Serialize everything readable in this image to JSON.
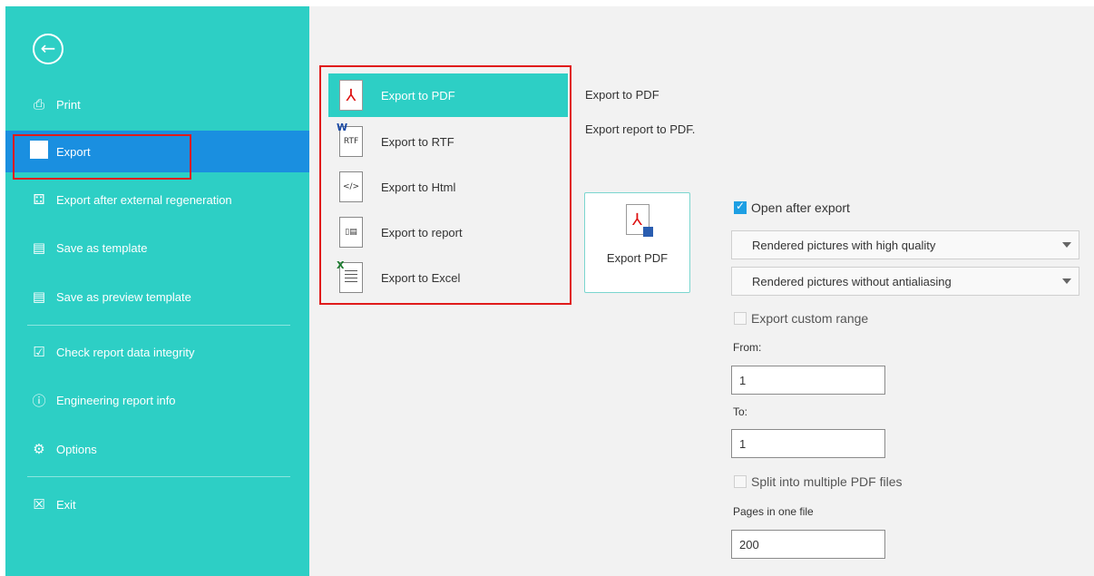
{
  "sidebar": {
    "back_icon": "arrow-left-circle-icon",
    "items": [
      {
        "label": "Print",
        "icon": "printer-icon"
      },
      {
        "label": "Export",
        "icon": "export-square-icon"
      },
      {
        "label": "Export after external regeneration",
        "icon": "regenerate-icon"
      },
      {
        "label": "Save as template",
        "icon": "template-icon"
      },
      {
        "label": "Save as preview template",
        "icon": "preview-template-icon"
      },
      {
        "label": "Check report data integrity",
        "icon": "check-doc-icon"
      },
      {
        "label": "Engineering report info",
        "icon": "info-doc-icon"
      },
      {
        "label": "Options",
        "icon": "gear-icon"
      },
      {
        "label": "Exit",
        "icon": "close-box-icon"
      }
    ]
  },
  "export_list": {
    "items": [
      {
        "label": "Export to PDF",
        "icon": "pdf-file-icon",
        "glyph": "⅄"
      },
      {
        "label": "Export to RTF",
        "icon": "rtf-file-icon",
        "glyph": "RTF"
      },
      {
        "label": "Export to Html",
        "icon": "html-file-icon",
        "glyph": "</>"
      },
      {
        "label": "Export to report",
        "icon": "report-file-icon",
        "glyph": "▯▤"
      },
      {
        "label": "Export to Excel",
        "icon": "excel-file-icon",
        "glyph": ""
      }
    ]
  },
  "detail": {
    "title": "Export to PDF",
    "description": "Export report to PDF.",
    "button_label": "Export PDF",
    "open_after_export": {
      "label": "Open after export",
      "checked": true
    },
    "quality_select": "Rendered pictures with high quality",
    "antialias_select": "Rendered pictures without antialiasing",
    "custom_range": {
      "label": "Export custom range",
      "checked": false
    },
    "from_label": "From:",
    "from_value": "1",
    "to_label": "To:",
    "to_value": "1",
    "split": {
      "label": "Split into multiple PDF files",
      "checked": false
    },
    "pages_label": "Pages in one file",
    "pages_value": "200"
  },
  "colors": {
    "sidebar": "#2dcfc5",
    "active_item": "#1a8fe0",
    "highlight": "#e01b1b",
    "checkbox_on": "#1d9fe3"
  }
}
